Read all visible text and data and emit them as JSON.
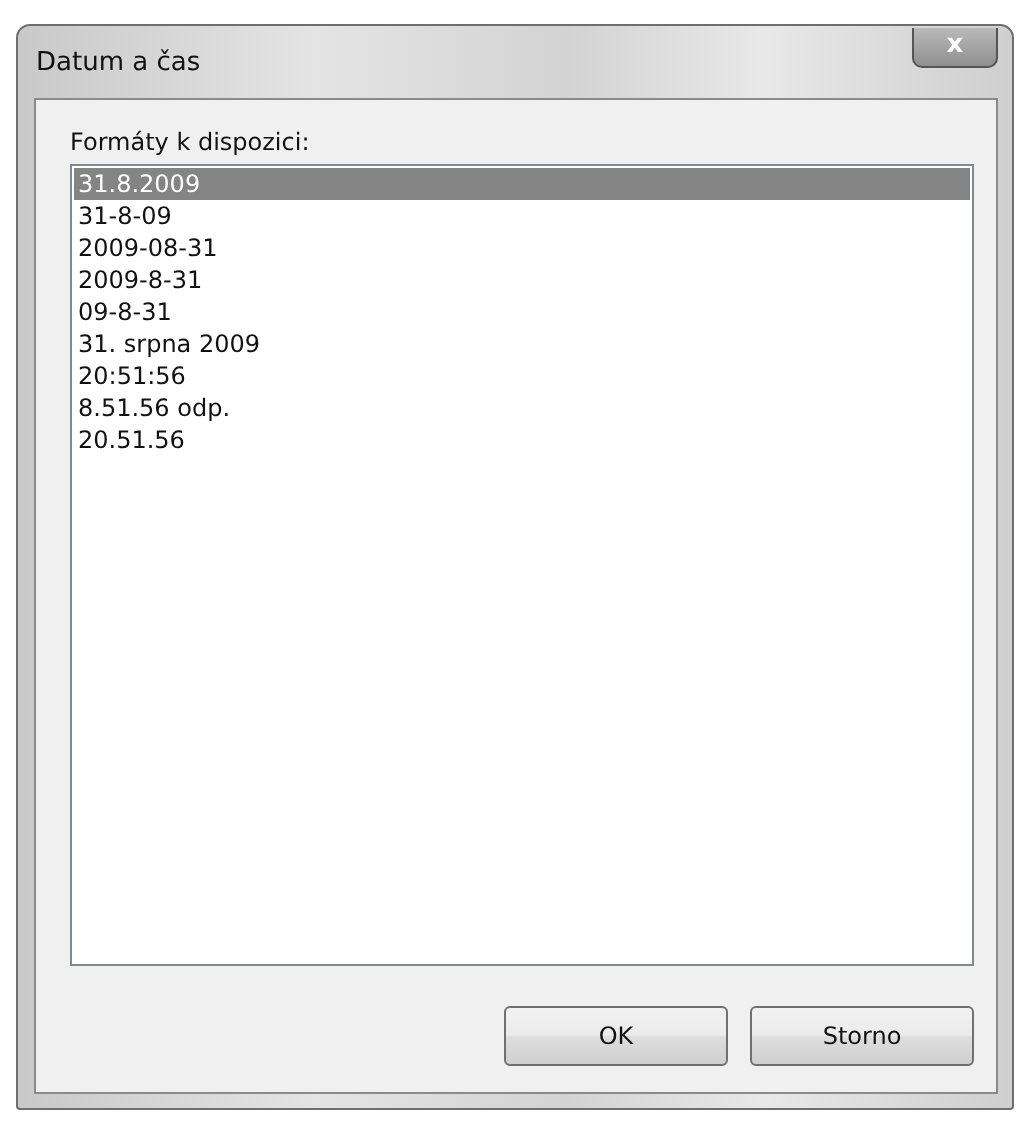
{
  "window": {
    "title": "Datum a čas",
    "close_button": "x"
  },
  "list_label": "Formáty k dispozici:",
  "formats": [
    {
      "label": "31.8.2009",
      "selected": true
    },
    {
      "label": "31-8-09",
      "selected": false
    },
    {
      "label": "2009-08-31",
      "selected": false
    },
    {
      "label": "2009-8-31",
      "selected": false
    },
    {
      "label": "09-8-31",
      "selected": false
    },
    {
      "label": "31. srpna 2009",
      "selected": false
    },
    {
      "label": "20:51:56",
      "selected": false
    },
    {
      "label": "8.51.56 odp.",
      "selected": false
    },
    {
      "label": "20.51.56",
      "selected": false
    }
  ],
  "buttons": [
    "OK",
    "Storno"
  ]
}
